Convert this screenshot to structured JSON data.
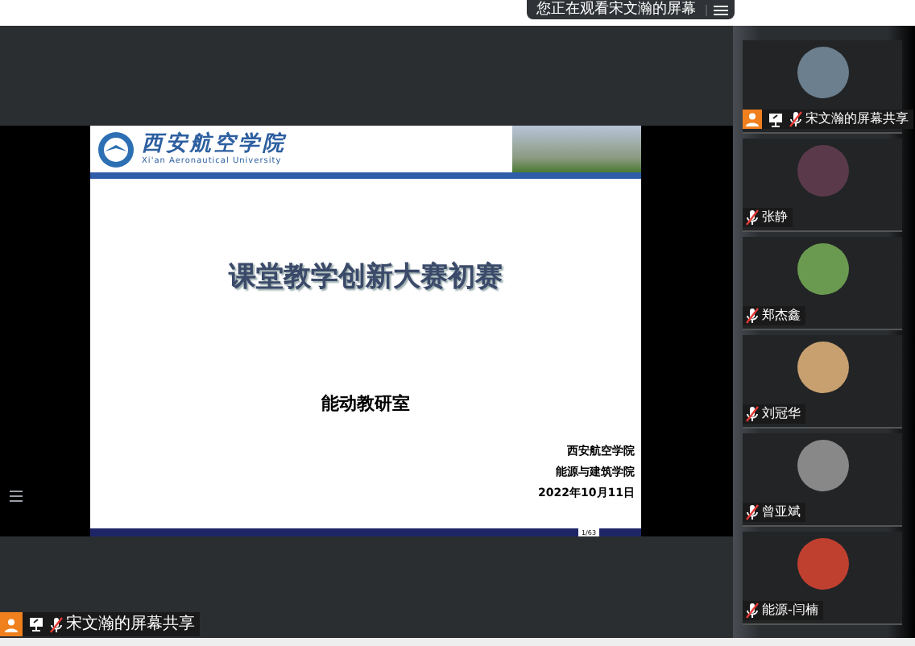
{
  "banner": {
    "text": "您正在观看宋文瀚的屏幕"
  },
  "slide": {
    "logo_name": "西安航空学院",
    "logo_subtitle": "Xi'an Aeronautical University",
    "title": "课堂教学创新大赛初赛",
    "subtitle": "能动教研室",
    "info": [
      "西安航空学院",
      "能源与建筑学院",
      "2022年10月11日"
    ],
    "page": "1/63"
  },
  "share_label": {
    "text": "宋文瀚的屏幕共享",
    "host": true,
    "sharing": true,
    "muted": true
  },
  "participants": [
    {
      "name": "宋文瀚的屏幕共享",
      "host": true,
      "sharing": true,
      "muted": true
    },
    {
      "name": "张静",
      "host": false,
      "sharing": false,
      "muted": true
    },
    {
      "name": "郑杰鑫",
      "host": false,
      "sharing": false,
      "muted": true
    },
    {
      "name": "刘冠华",
      "host": false,
      "sharing": false,
      "muted": true
    },
    {
      "name": "曾亚斌",
      "host": false,
      "sharing": false,
      "muted": true
    },
    {
      "name": "能源-闫楠",
      "host": false,
      "sharing": false,
      "muted": true
    }
  ]
}
